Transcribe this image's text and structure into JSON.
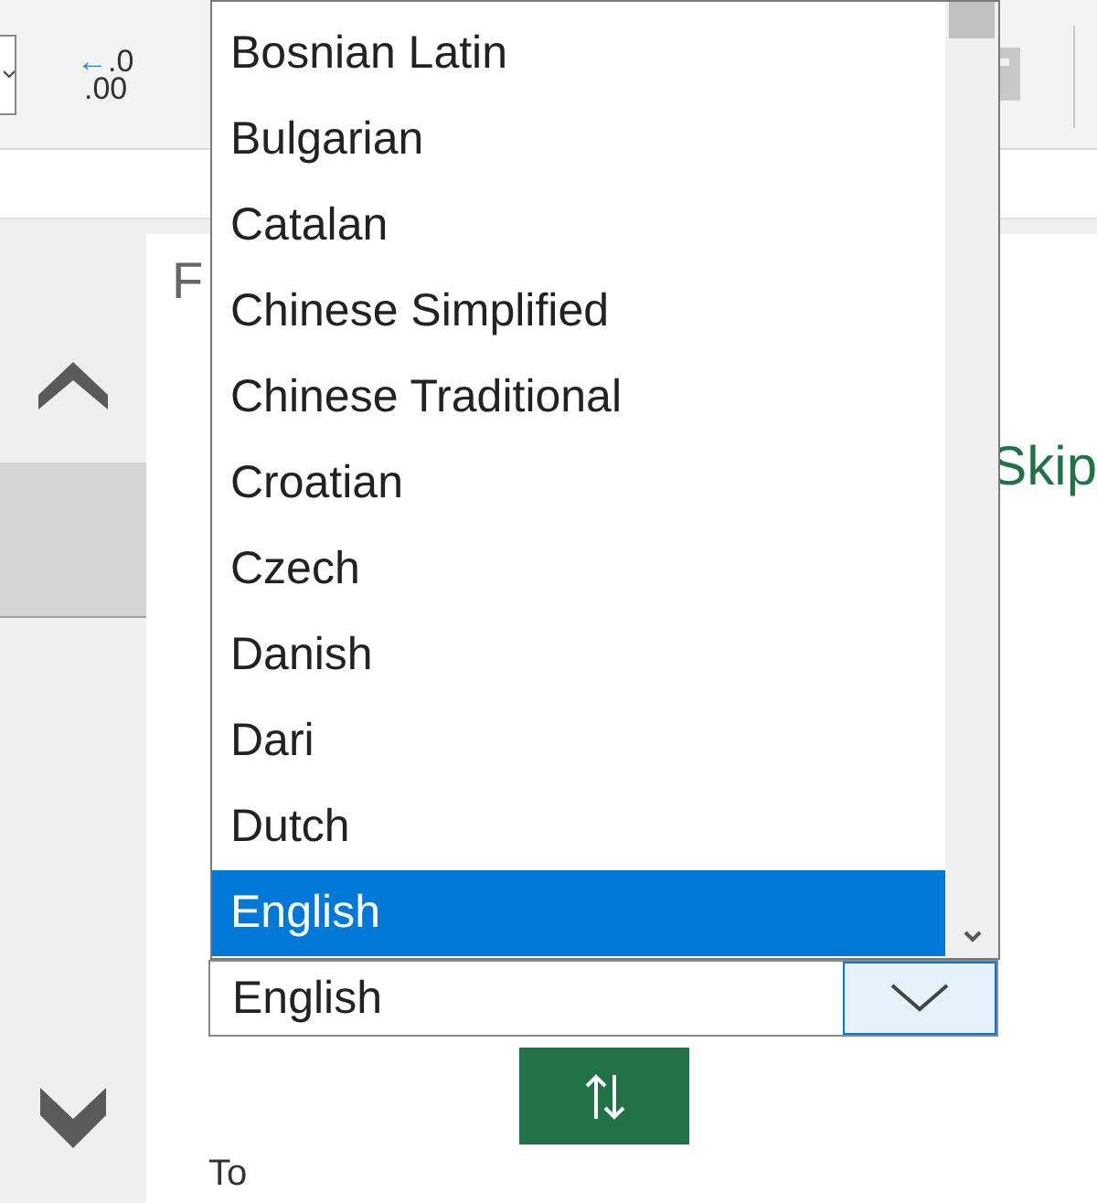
{
  "ribbon": {
    "decrease_decimal_button": {
      "arrow": "←",
      "line1": ".0",
      "line2": ".00"
    }
  },
  "panel": {
    "heading": "F",
    "skip_link": "Skip",
    "from_select": {
      "value": "English",
      "open": true
    },
    "to_label": "To"
  },
  "language_dropdown": {
    "options": [
      {
        "label": "Bosnian Latin",
        "selected": false
      },
      {
        "label": "Bulgarian",
        "selected": false
      },
      {
        "label": "Catalan",
        "selected": false
      },
      {
        "label": "Chinese Simplified",
        "selected": false
      },
      {
        "label": "Chinese Traditional",
        "selected": false
      },
      {
        "label": "Croatian",
        "selected": false
      },
      {
        "label": "Czech",
        "selected": false
      },
      {
        "label": "Danish",
        "selected": false
      },
      {
        "label": "Dari",
        "selected": false
      },
      {
        "label": "Dutch",
        "selected": false
      },
      {
        "label": "English",
        "selected": true
      }
    ]
  }
}
